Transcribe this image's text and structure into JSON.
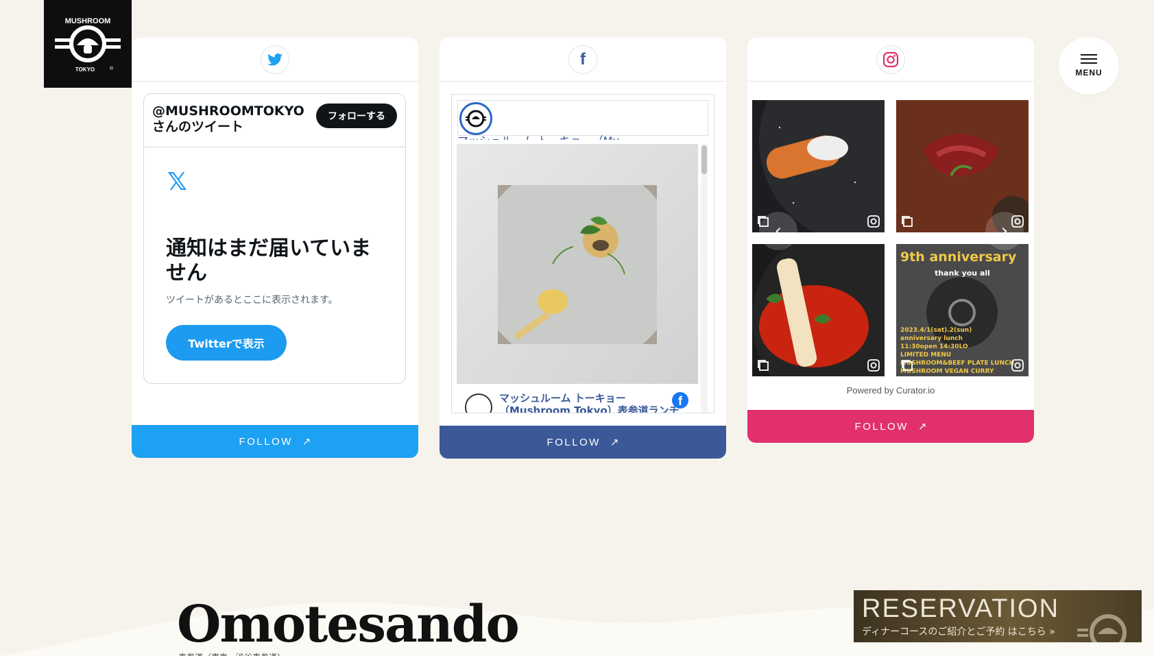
{
  "brand": {
    "logo_top": "MUSHROOM",
    "logo_bottom": "TOKYO",
    "logo_mark": "®"
  },
  "menu": {
    "label": "MENU"
  },
  "twitter": {
    "handle_line": "@MUSHROOMTOKYOさんのツイート",
    "follow_button": "フォローする",
    "x_glyph": "𝕏",
    "empty_title": "通知はまだ届いていません",
    "empty_sub": "ツイートがあるとここに表示されます。",
    "view_button": "Twitterで表示",
    "follow_bar": "FOLLOW",
    "color": "#1da1f2"
  },
  "facebook": {
    "page_name_cut": "マッシュルーム トーキョー（Mu",
    "post_name": "マッシュルーム トーキョー",
    "post_name_cut": "（Mushroom Tokyo）表参道ランチ",
    "fb_glyph": "f",
    "follow_bar": "FOLLOW",
    "color": "#3b5998"
  },
  "instagram": {
    "powered_by": "Powered by Curator.io",
    "follow_bar": "FOLLOW",
    "color": "#e1306c",
    "prev": "‹",
    "next": "›",
    "anniv_title": "9th anniversary",
    "anniv_sub": "thank you all",
    "anniv_lines": [
      "2023.4/1(sat).2(sun)",
      "anniversary lunch",
      "11:30open 14:30LO",
      "LIMITED MENU",
      "MUSHROOM&BEEF PLATE LUNCH",
      "MUSHROOM VEGAN CURRY"
    ]
  },
  "follow_arrow": "↗",
  "section": {
    "title": "Omotesando",
    "subtitle_cut": "表参道（東京・渋谷表参道）"
  },
  "reservation": {
    "title": "RESERVATION",
    "sub": "ディナーコースのご紹介とご予約 はこちら »"
  }
}
